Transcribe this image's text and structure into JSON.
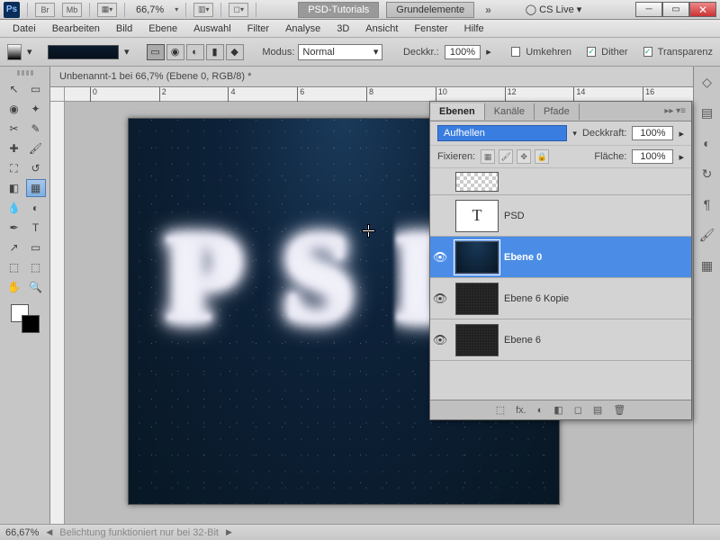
{
  "titlebar": {
    "ps_label": "Ps",
    "boxes": [
      "Br",
      "Mb"
    ],
    "zoom": "66,7%",
    "crumb_active": "PSD-Tutorials",
    "crumb_inactive": "Grundelemente",
    "cslive": "CS Live"
  },
  "menu": [
    "Datei",
    "Bearbeiten",
    "Bild",
    "Ebene",
    "Auswahl",
    "Filter",
    "Analyse",
    "3D",
    "Ansicht",
    "Fenster",
    "Hilfe"
  ],
  "options": {
    "modus_label": "Modus:",
    "modus_value": "Normal",
    "opacity_label": "Deckkr.:",
    "opacity_value": "100%",
    "umkehren_label": "Umkehren",
    "umkehren_checked": false,
    "dither_label": "Dither",
    "dither_checked": true,
    "transp_label": "Transparenz",
    "transp_checked": true
  },
  "doc_tab": "Unbenannt-1 bei 66,7% (Ebene 0, RGB/8) *",
  "ruler_h": [
    "0",
    "2",
    "4",
    "6",
    "8",
    "10",
    "12",
    "14",
    "16"
  ],
  "layers_panel": {
    "tabs": [
      "Ebenen",
      "Kanäle",
      "Pfade"
    ],
    "active_tab": 0,
    "blend_mode": "Aufhellen",
    "opacity_label": "Deckkraft:",
    "opacity_value": "100%",
    "lock_label": "Fixieren:",
    "fill_label": "Fläche:",
    "fill_value": "100%",
    "layers": [
      {
        "visible": false,
        "thumb": "checker",
        "name": "",
        "sel": false,
        "glyph": ""
      },
      {
        "visible": false,
        "thumb": "white",
        "name": "PSD",
        "sel": false,
        "glyph": "T"
      },
      {
        "visible": true,
        "thumb": "dark",
        "name": "Ebene 0",
        "sel": true,
        "glyph": ""
      },
      {
        "visible": true,
        "thumb": "noise",
        "name": "Ebene 6 Kopie",
        "sel": false,
        "glyph": ""
      },
      {
        "visible": true,
        "thumb": "noise",
        "name": "Ebene 6",
        "sel": false,
        "glyph": ""
      }
    ],
    "footer_icons": [
      "⬚",
      "fx.",
      "◐",
      "◧",
      "◻",
      "▤",
      "🗑"
    ]
  },
  "status": {
    "zoom": "66,67%",
    "msg": "Belichtung funktioniert nur bei 32-Bit"
  }
}
